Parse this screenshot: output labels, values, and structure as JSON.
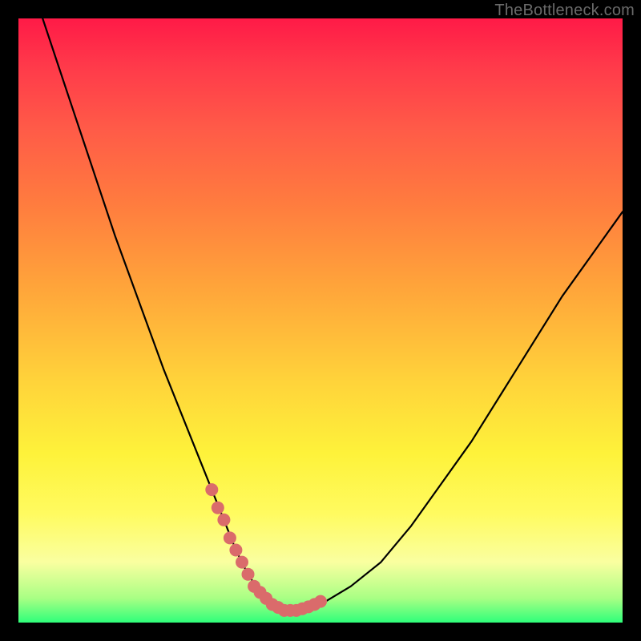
{
  "watermark": "TheBottleneck.com",
  "chart_data": {
    "type": "line",
    "title": "",
    "xlabel": "",
    "ylabel": "",
    "xlim": [
      0,
      100
    ],
    "ylim": [
      0,
      100
    ],
    "grid": false,
    "legend": false,
    "series": [
      {
        "name": "bottleneck-curve",
        "x": [
          4,
          8,
          12,
          16,
          20,
          24,
          28,
          32,
          34,
          36,
          38,
          40,
          42,
          44,
          46,
          50,
          55,
          60,
          65,
          70,
          75,
          80,
          85,
          90,
          95,
          100
        ],
        "y": [
          100,
          88,
          76,
          64,
          53,
          42,
          32,
          22,
          17,
          12,
          8,
          5,
          3,
          2,
          2,
          3,
          6,
          10,
          16,
          23,
          30,
          38,
          46,
          54,
          61,
          68
        ]
      }
    ],
    "highlight": {
      "name": "min-region",
      "x": [
        32,
        33,
        34,
        35,
        36,
        37,
        38,
        39,
        40,
        41,
        42,
        43,
        44,
        45,
        46,
        47,
        48,
        49,
        50
      ],
      "y": [
        22,
        19,
        17,
        14,
        12,
        10,
        8,
        6,
        5,
        4,
        3,
        2.5,
        2,
        2,
        2,
        2.3,
        2.6,
        3,
        3.5
      ]
    },
    "background_gradient": [
      "#ff1a47",
      "#ff7a3f",
      "#fef23a",
      "#2fff7a"
    ]
  }
}
